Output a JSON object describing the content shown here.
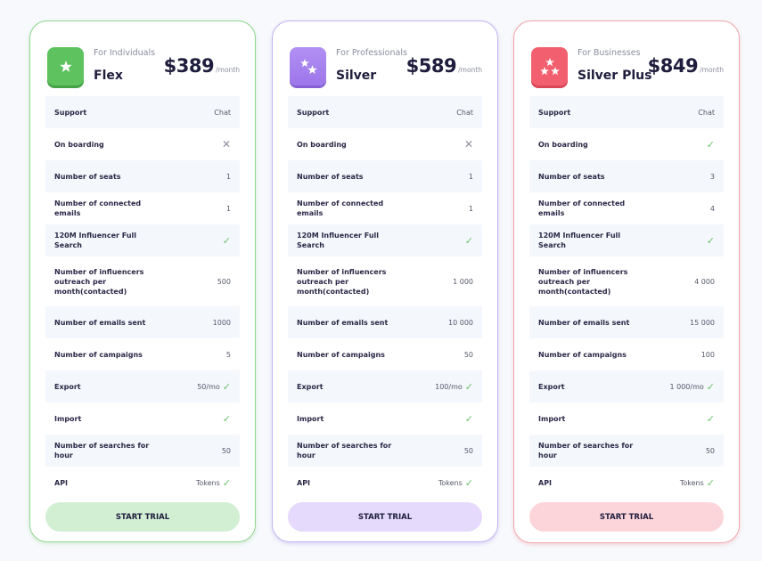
{
  "plans": [
    {
      "for_label": "For Individuals",
      "name": "Flex",
      "price": "$389",
      "period": "/month",
      "icon": "one-star-icon",
      "accent": "#5ec25f",
      "button": "START TRIAL",
      "features": [
        {
          "label": "Support",
          "value": "Chat",
          "status": ""
        },
        {
          "label": "On boarding",
          "value": "",
          "status": "cross"
        },
        {
          "label": "Number of seats",
          "value": "1",
          "status": ""
        },
        {
          "label": "Number of connected emails",
          "value": "1",
          "status": ""
        },
        {
          "label": "120M Influencer Full Search",
          "value": "",
          "status": "check"
        },
        {
          "label": "Number of influencers outreach per month(contacted)",
          "value": "500",
          "status": ""
        },
        {
          "label": "Number of emails sent",
          "value": "1000",
          "status": ""
        },
        {
          "label": "Number of campaigns",
          "value": "5",
          "status": ""
        },
        {
          "label": "Export",
          "value": "50/mo",
          "status": "check"
        },
        {
          "label": "Import",
          "value": "",
          "status": "check"
        },
        {
          "label": "Number of searches for hour",
          "value": "50",
          "status": ""
        },
        {
          "label": "API",
          "value": "Tokens",
          "status": "check"
        }
      ]
    },
    {
      "for_label": "For Professionals",
      "name": "Silver",
      "price": "$589",
      "period": "/month",
      "icon": "two-stars-icon",
      "accent": "#a582ee",
      "button": "START TRIAL",
      "features": [
        {
          "label": "Support",
          "value": "Chat",
          "status": ""
        },
        {
          "label": "On boarding",
          "value": "",
          "status": "cross"
        },
        {
          "label": "Number of seats",
          "value": "1",
          "status": ""
        },
        {
          "label": "Number of connected emails",
          "value": "1",
          "status": ""
        },
        {
          "label": "120M Influencer Full Search",
          "value": "",
          "status": "check"
        },
        {
          "label": "Number of influencers outreach per month(contacted)",
          "value": "1 000",
          "status": ""
        },
        {
          "label": "Number of emails sent",
          "value": "10 000",
          "status": ""
        },
        {
          "label": "Number of campaigns",
          "value": "50",
          "status": ""
        },
        {
          "label": "Export",
          "value": "100/mo",
          "status": "check"
        },
        {
          "label": "Import",
          "value": "",
          "status": "check"
        },
        {
          "label": "Number of searches for hour",
          "value": "50",
          "status": ""
        },
        {
          "label": "API",
          "value": "Tokens",
          "status": "check"
        }
      ]
    },
    {
      "for_label": "For Businesses",
      "name": "Silver Plus",
      "price": "$849",
      "period": "/month",
      "icon": "three-stars-icon",
      "accent": "#f2606f",
      "button": "START TRIAL",
      "features": [
        {
          "label": "Support",
          "value": "Chat",
          "status": ""
        },
        {
          "label": "On boarding",
          "value": "",
          "status": "check"
        },
        {
          "label": "Number of seats",
          "value": "3",
          "status": ""
        },
        {
          "label": "Number of connected emails",
          "value": "4",
          "status": ""
        },
        {
          "label": "120M Influencer Full Search",
          "value": "",
          "status": "check"
        },
        {
          "label": "Number of influencers outreach per month(contacted)",
          "value": "4 000",
          "status": ""
        },
        {
          "label": "Number of emails sent",
          "value": "15 000",
          "status": ""
        },
        {
          "label": "Number of campaigns",
          "value": "100",
          "status": ""
        },
        {
          "label": "Export",
          "value": "1 000/mo",
          "status": "check"
        },
        {
          "label": "Import",
          "value": "",
          "status": "check"
        },
        {
          "label": "Number of searches for hour",
          "value": "50",
          "status": ""
        },
        {
          "label": "API",
          "value": "Tokens",
          "status": "check"
        }
      ]
    }
  ]
}
